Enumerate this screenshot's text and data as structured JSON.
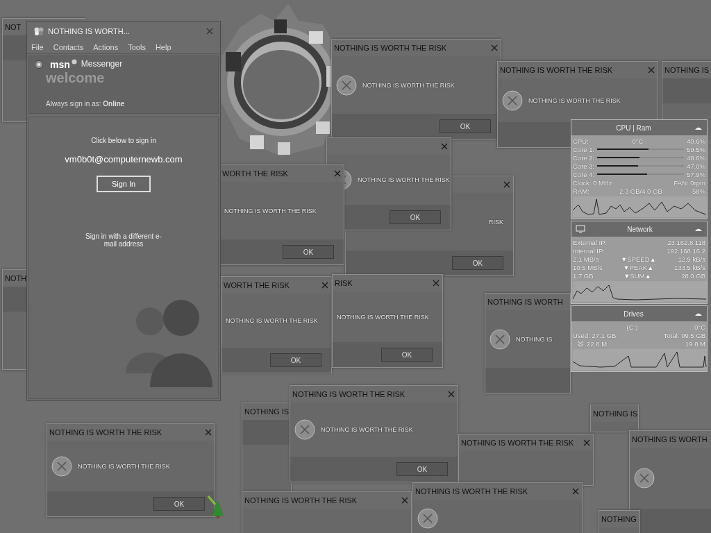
{
  "desktop": {
    "dialogs": [
      {
        "title": "NOT"
      },
      {
        "title": "NOTH"
      },
      {
        "title": "NOTHING IS"
      },
      {
        "message": "RISK",
        "button": "OK"
      },
      {
        "title": "NOTHING IS WORTH THE RISK",
        "message": "NOTHING IS WORTH THE RISK",
        "button": "OK"
      },
      {
        "message": "NOTHING IS WORTH THE RISK",
        "button": "OK"
      },
      {
        "title": "NOTHING IS WORTH THE RISK",
        "message": "NOTHING IS WORTH THE RISK"
      },
      {
        "title": "WORTH THE RISK",
        "message": "NOTHING IS WORTH THE RISK",
        "button": "OK"
      },
      {
        "title": "WORTH THE RISK",
        "message": "NOTHING IS WORTH THE RISK",
        "button": "OK"
      },
      {
        "title": "RISK",
        "message": "NOTHING IS WORTH THE RISK",
        "button": "OK"
      },
      {
        "title": "NOTHING IS WORTH",
        "message": "NOTHING IS"
      },
      {
        "title": "NOTHING IS"
      },
      {
        "title": "NOTHING IS WORTH"
      },
      {
        "title": "NOTHING IS"
      },
      {
        "title": "NOTHING IS WORTH THE RISK",
        "message": "NOTHING IS WORTH THE RISK",
        "button": "OK"
      },
      {
        "title": "NOTHING IS WORTH THE RISK",
        "message": "NOTHING IS WORTH THE RISK",
        "button": "OK"
      },
      {
        "title": "NOTHING IS WORTH THE RISK"
      },
      {
        "title": "NOTHING IS WORTH THE RISK"
      },
      {
        "title": "NOTHING IS WORTH THE RISK"
      },
      {
        "title": "NOTHING"
      }
    ]
  },
  "messenger": {
    "title": "NOTHING IS WORTH...",
    "menu": [
      "File",
      "Contacts",
      "Actions",
      "Tools",
      "Help"
    ],
    "brand": "msn",
    "product": "Messenger",
    "welcome": "welcome",
    "status_line": "Always sign in as: **Online**",
    "prompt": "Click below to sign in",
    "email": "vm0b0t@computernewb.com",
    "sign_in_button": "Sign In",
    "alternate_link": "Sign in with a different e-mail address"
  },
  "cpu_meter": {
    "title": "CPU | Ram",
    "cpu_label": "CPU:",
    "temperature": "0°C",
    "cpu_usage": "40.6%",
    "cores": [
      {
        "label": "Core 1:",
        "level": 0.595,
        "usage": "59.5%"
      },
      {
        "label": "Core 2:",
        "level": 0.486,
        "usage": "48.6%"
      },
      {
        "label": "Core 3:",
        "level": 0.47,
        "usage": "47.0%"
      },
      {
        "label": "Core 4:",
        "level": 0.579,
        "usage": "57.9%"
      }
    ],
    "clock": "Clock: 0 MHz",
    "fan": "FAN: 0rpm",
    "ram_label": "RAM:",
    "ram_amount": "2.3 GB/4.0 GB",
    "ram_usage": "58%"
  },
  "network_meter": {
    "title": "Network",
    "addresses": [
      {
        "label": "External IP:",
        "value": "23.162.8.118"
      },
      {
        "label": "Internal IP:",
        "value": "192.168.16.2"
      }
    ],
    "rates": [
      {
        "download": "2.1 MB/s",
        "label": "▼SPEED▲",
        "upload": "12.9 kB/s"
      },
      {
        "download": "10.5 MB/s",
        "label": "▼PEAK▲",
        "upload": "133.5 kB/s"
      },
      {
        "download": "1.7 GB",
        "label": "▼SUM▲",
        "upload": "28.0 GB"
      }
    ]
  },
  "drive_meter": {
    "title": "Drives",
    "drive": "(C:)",
    "temperature": "0°C",
    "used": "Used: 27.1 GB",
    "total": "Total: 99.5 GB",
    "read": "22.8 M",
    "write": "19.8 M"
  }
}
